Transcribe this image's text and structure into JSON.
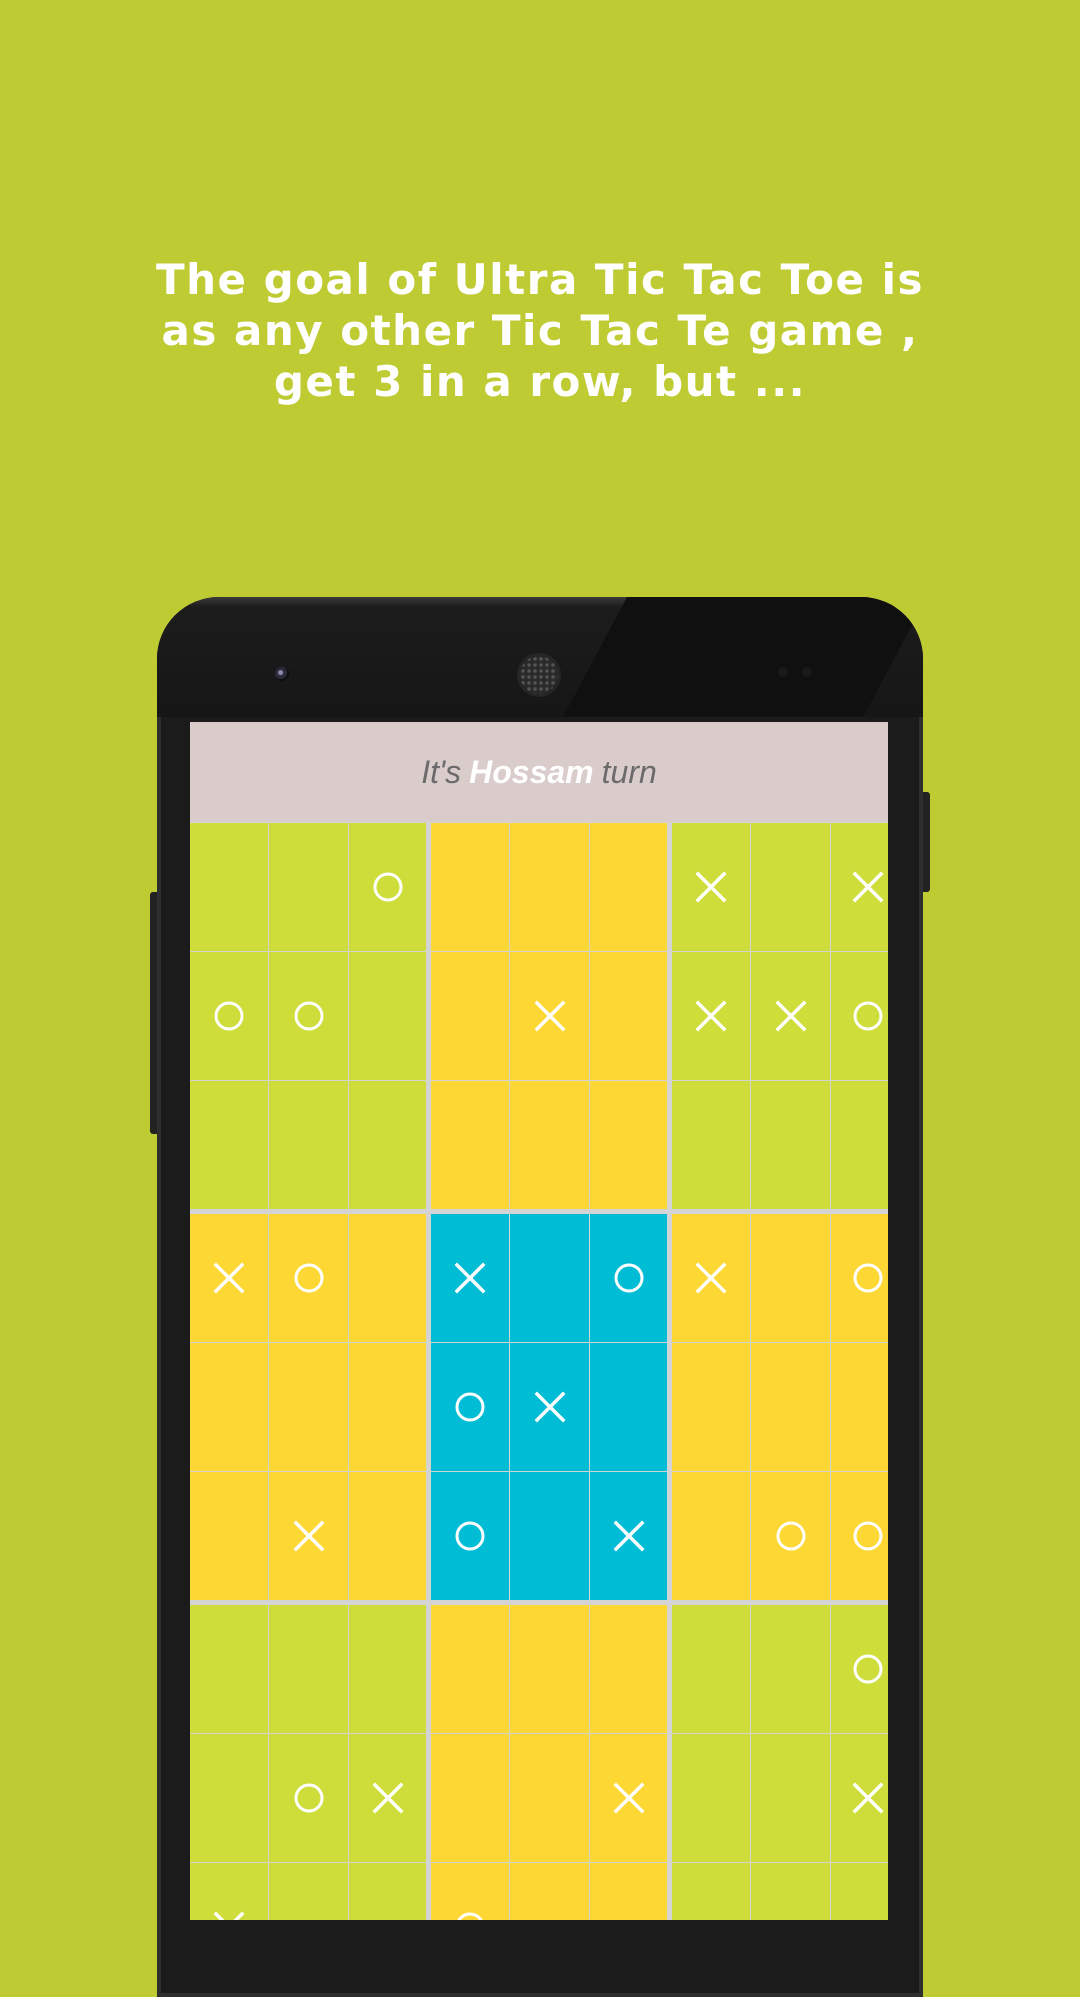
{
  "headline": {
    "lines": [
      "The goal of Ultra Tic Tac Toe is",
      "as any other Tic Tac Te game ,",
      "get 3 in a row, but ..."
    ]
  },
  "turn_banner": {
    "prefix": "It's",
    "player": "Hossam",
    "suffix": "turn"
  },
  "colors": {
    "background": "#bfcb33",
    "board_green": "#cedd3a",
    "board_yellow": "#fdd835",
    "board_cyan": "#00bcd4",
    "mark": "#ffffff",
    "turn_bar": "#d9ccca"
  },
  "board": {
    "sub_board_colors": [
      [
        "board_green",
        "board_yellow",
        "board_green"
      ],
      [
        "board_yellow",
        "board_cyan",
        "board_yellow"
      ],
      [
        "board_green",
        "board_yellow",
        "board_green"
      ]
    ],
    "cells": [
      [
        "",
        "",
        "O",
        "",
        "",
        "",
        "X",
        "",
        "X"
      ],
      [
        "O",
        "O",
        "",
        "",
        "X",
        "",
        "X",
        "X",
        "O"
      ],
      [
        "",
        "",
        "",
        "",
        "",
        "",
        "",
        "",
        ""
      ],
      [
        "X",
        "O",
        "",
        "X",
        "",
        "O",
        "X",
        "",
        "O"
      ],
      [
        "",
        "",
        "",
        "O",
        "X",
        "",
        "",
        "",
        ""
      ],
      [
        "",
        "X",
        "",
        "O",
        "",
        "X",
        "",
        "O",
        "O"
      ],
      [
        "",
        "",
        "",
        "",
        "",
        "",
        "",
        "",
        "O"
      ],
      [
        "",
        "O",
        "X",
        "",
        "",
        "X",
        "",
        "",
        "X"
      ],
      [
        "X",
        "",
        "",
        "O",
        "",
        "",
        "",
        "",
        ""
      ]
    ]
  }
}
